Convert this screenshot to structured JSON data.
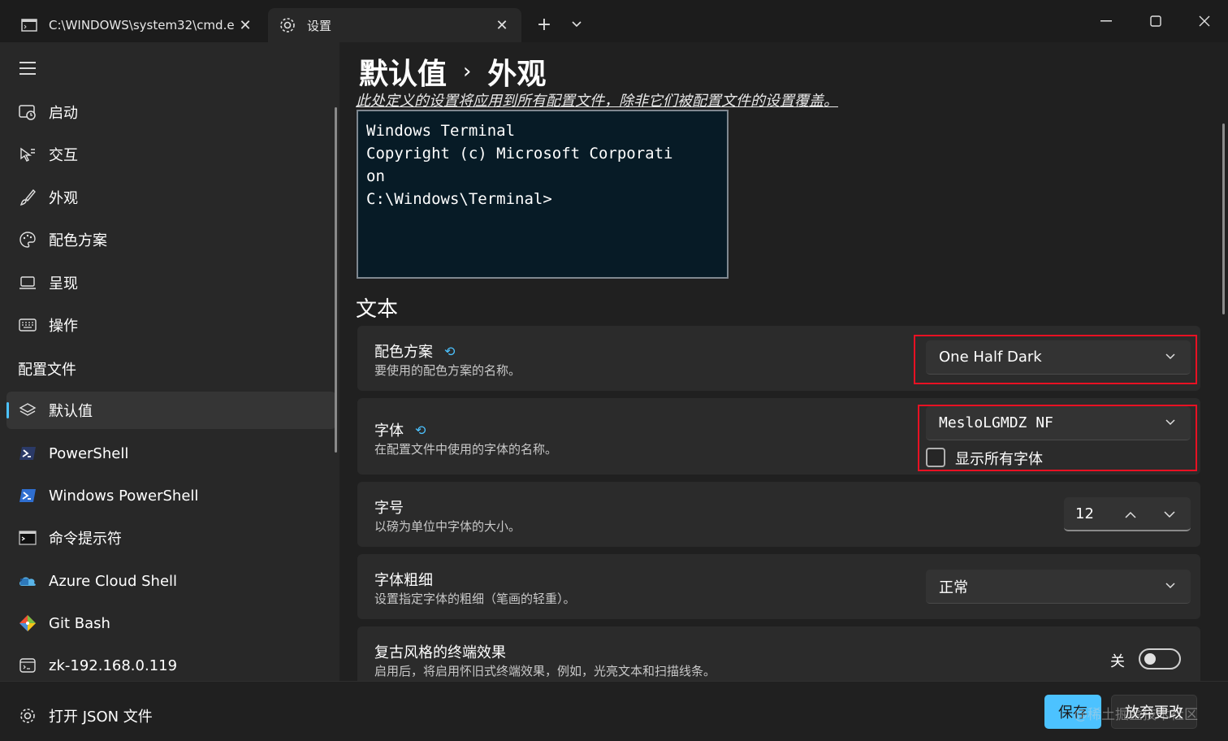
{
  "tabs": [
    {
      "label": "C:\\WINDOWS\\system32\\cmd.e",
      "icon": "console-icon",
      "active": false
    },
    {
      "label": "设置",
      "icon": "gear-icon",
      "active": true
    }
  ],
  "window_controls": {
    "minimize": "–",
    "maximize": "☐",
    "close": "✕",
    "new_tab": "+",
    "close_tab": "✕"
  },
  "sidebar": {
    "items": [
      {
        "label": "启动",
        "icon": "startup-icon"
      },
      {
        "label": "交互",
        "icon": "interaction-icon"
      },
      {
        "label": "外观",
        "icon": "brush-icon"
      },
      {
        "label": "配色方案",
        "icon": "palette-icon"
      },
      {
        "label": "呈现",
        "icon": "monitor-icon"
      },
      {
        "label": "操作",
        "icon": "keyboard-icon"
      }
    ],
    "profiles_header": "配置文件",
    "profiles": [
      {
        "label": "默认值",
        "icon": "layers-icon",
        "selected": true
      },
      {
        "label": "PowerShell",
        "icon": "powershell-icon"
      },
      {
        "label": "Windows PowerShell",
        "icon": "windows-powershell-icon"
      },
      {
        "label": "命令提示符",
        "icon": "cmd-icon"
      },
      {
        "label": "Azure Cloud Shell",
        "icon": "azure-icon"
      },
      {
        "label": "Git Bash",
        "icon": "git-icon"
      },
      {
        "label": "zk-192.168.0.119",
        "icon": "ssh-icon"
      }
    ],
    "open_json": "打开 JSON 文件"
  },
  "main": {
    "breadcrumb": {
      "parent": "默认值",
      "separator": "›",
      "current": "外观"
    },
    "subtitle": "此处定义的设置将应用到所有配置文件，除非它们被配置文件的设置覆盖。",
    "preview_lines": [
      "Windows Terminal",
      "Copyright (c) Microsoft Corporati",
      "on",
      "",
      "C:\\Windows\\Terminal>"
    ],
    "section_text": "文本",
    "color_scheme": {
      "title": "配色方案",
      "desc": "要使用的配色方案的名称。",
      "value": "One Half Dark"
    },
    "font_face": {
      "title": "字体",
      "desc": "在配置文件中使用的字体的名称。",
      "value": "MesloLGMDZ NF",
      "show_all_label": "显示所有字体",
      "show_all_checked": false
    },
    "font_size": {
      "title": "字号",
      "desc": "以磅为单位中字体的大小。",
      "value": "12"
    },
    "font_weight": {
      "title": "字体粗细",
      "desc": "设置指定字体的粗细（笔画的轻重）。",
      "value": "正常"
    },
    "retro": {
      "title": "复古风格的终端效果",
      "desc": "启用后，将启用怀旧式终端效果，例如，光亮文本和扫描线条。",
      "state_label": "关",
      "enabled": false
    }
  },
  "footer": {
    "save": "保存",
    "discard": "放弃更改",
    "watermark": "@稀土掘金技术社区"
  },
  "colors": {
    "accent": "#4cc2ff",
    "highlight_box": "#e81123",
    "preview_bg": "#071b26"
  }
}
